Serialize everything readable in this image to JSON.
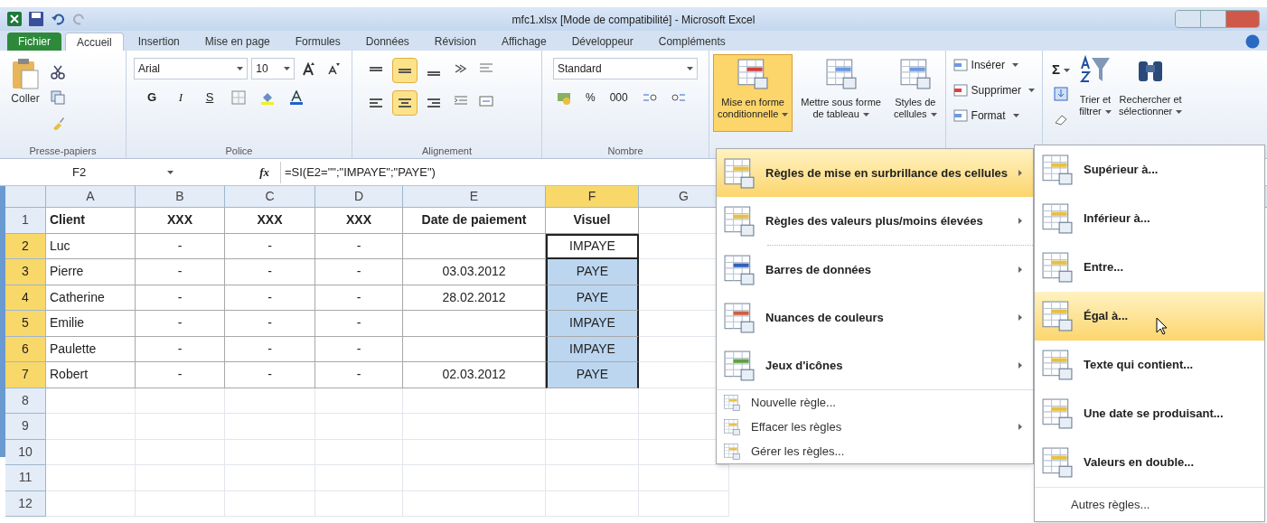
{
  "window": {
    "title": "mfc1.xlsx  [Mode de compatibilité]  -  Microsoft Excel"
  },
  "ribbon_tabs": [
    {
      "label": "Fichier",
      "kind": "file",
      "selected": false
    },
    {
      "label": "Accueil",
      "kind": "tab",
      "selected": true
    },
    {
      "label": "Insertion",
      "kind": "tab",
      "selected": false
    },
    {
      "label": "Mise en page",
      "kind": "tab",
      "selected": false
    },
    {
      "label": "Formules",
      "kind": "tab",
      "selected": false
    },
    {
      "label": "Données",
      "kind": "tab",
      "selected": false
    },
    {
      "label": "Révision",
      "kind": "tab",
      "selected": false
    },
    {
      "label": "Affichage",
      "kind": "tab",
      "selected": false
    },
    {
      "label": "Développeur",
      "kind": "tab",
      "selected": false
    },
    {
      "label": "Compléments",
      "kind": "tab",
      "selected": false
    }
  ],
  "ribbon": {
    "clipboard": {
      "paste_label": "Coller",
      "group_label": "Presse-papiers"
    },
    "font": {
      "font_name": "Arial",
      "font_size": "10",
      "bold": "G",
      "italic": "I",
      "underline": "S",
      "group_label": "Police"
    },
    "alignment": {
      "top_row": [
        {
          "selected": false
        },
        {
          "selected": true
        },
        {
          "selected": false
        }
      ],
      "bottom_row": [
        {
          "selected": false
        },
        {
          "selected": true
        },
        {
          "selected": false
        }
      ],
      "group_label": "Alignement"
    },
    "number": {
      "format": "Standard",
      "percent": "%",
      "thousands": "000",
      "group_label": "Nombre"
    },
    "styles": [
      {
        "line1": "Mise en forme",
        "line2": "conditionnelle",
        "selected": true
      },
      {
        "line1": "Mettre sous forme",
        "line2": "de tableau",
        "selected": false
      },
      {
        "line1": "Styles de",
        "line2": "cellules",
        "selected": false
      }
    ],
    "cells": [
      "Insérer",
      "Supprimer",
      "Format"
    ],
    "editing": {
      "sigma": "Σ",
      "sort": [
        "Trier et",
        "filtrer"
      ],
      "find": [
        "Rechercher et",
        "sélectionner"
      ]
    }
  },
  "formula_bar": {
    "name_box": "F2",
    "function_label": "fx",
    "formula": "=SI(E2=\"\";\"IMPAYE\";\"PAYE\")"
  },
  "sheet": {
    "columns": [
      {
        "label": "A",
        "selected": false
      },
      {
        "label": "B",
        "selected": false
      },
      {
        "label": "C",
        "selected": false
      },
      {
        "label": "D",
        "selected": false
      },
      {
        "label": "E",
        "selected": false
      },
      {
        "label": "F",
        "selected": true
      },
      {
        "label": "G",
        "selected": false
      }
    ],
    "rows": [
      {
        "number": "1",
        "kind": "header",
        "selected": false,
        "active": false,
        "cells": [
          "Client",
          "XXX",
          "XXX",
          "XXX",
          "Date de paiement",
          "Visuel"
        ]
      },
      {
        "number": "2",
        "kind": "data",
        "selected": true,
        "active": true,
        "cells": [
          "Luc",
          "-",
          "-",
          "-",
          "",
          "IMPAYE"
        ]
      },
      {
        "number": "3",
        "kind": "data",
        "selected": true,
        "active": false,
        "cells": [
          "Pierre",
          "-",
          "-",
          "-",
          "03.03.2012",
          "PAYE"
        ]
      },
      {
        "number": "4",
        "kind": "data",
        "selected": true,
        "active": false,
        "cells": [
          "Catherine",
          "-",
          "-",
          "-",
          "28.02.2012",
          "PAYE"
        ]
      },
      {
        "number": "5",
        "kind": "data",
        "selected": true,
        "active": false,
        "cells": [
          "Emilie",
          "-",
          "-",
          "-",
          "",
          "IMPAYE"
        ]
      },
      {
        "number": "6",
        "kind": "data",
        "selected": true,
        "active": false,
        "cells": [
          "Paulette",
          "-",
          "-",
          "-",
          "",
          "IMPAYE"
        ]
      },
      {
        "number": "7",
        "kind": "data",
        "selected": true,
        "active": false,
        "cells": [
          "Robert",
          "-",
          "-",
          "-",
          "02.03.2012",
          "PAYE"
        ]
      },
      {
        "number": "8",
        "kind": "empty",
        "selected": false,
        "active": false,
        "cells": []
      },
      {
        "number": "9",
        "kind": "empty",
        "selected": false,
        "active": false,
        "cells": []
      },
      {
        "number": "10",
        "kind": "empty",
        "selected": false,
        "active": false,
        "cells": []
      },
      {
        "number": "11",
        "kind": "empty",
        "selected": false,
        "active": false,
        "cells": []
      },
      {
        "number": "12",
        "kind": "empty",
        "selected": false,
        "active": false,
        "cells": []
      }
    ]
  },
  "menu": {
    "items": [
      {
        "label": "Règles de mise en surbrillance des cellules",
        "kind": "large",
        "submenu": true,
        "selected": true
      },
      {
        "label": "Règles des valeurs plus/moins élevées",
        "kind": "large",
        "submenu": true,
        "selected": false
      },
      {
        "label": "Barres de données",
        "kind": "large",
        "submenu": true,
        "selected": false
      },
      {
        "label": "Nuances de couleurs",
        "kind": "large",
        "submenu": true,
        "selected": false
      },
      {
        "label": "Jeux d'icônes",
        "kind": "large",
        "submenu": true,
        "selected": false
      },
      {
        "label": "Nouvelle règle...",
        "kind": "small",
        "submenu": false,
        "selected": false
      },
      {
        "label": "Effacer les règles",
        "kind": "small",
        "submenu": true,
        "selected": false
      },
      {
        "label": "Gérer les règles...",
        "kind": "small",
        "submenu": false,
        "selected": false
      }
    ]
  },
  "submenu": {
    "items": [
      {
        "label": "Supérieur à...",
        "kind": "large",
        "selected": false
      },
      {
        "label": "Inférieur à...",
        "kind": "large",
        "selected": false
      },
      {
        "label": "Entre...",
        "kind": "large",
        "selected": false
      },
      {
        "label": "Égal à...",
        "kind": "large",
        "selected": true
      },
      {
        "label": "Texte qui contient...",
        "kind": "large",
        "selected": false
      },
      {
        "label": "Une date se produisant...",
        "kind": "large",
        "selected": false
      },
      {
        "label": "Valeurs en double...",
        "kind": "large",
        "selected": false
      },
      {
        "label": "Autres règles...",
        "kind": "small",
        "selected": false
      }
    ]
  }
}
